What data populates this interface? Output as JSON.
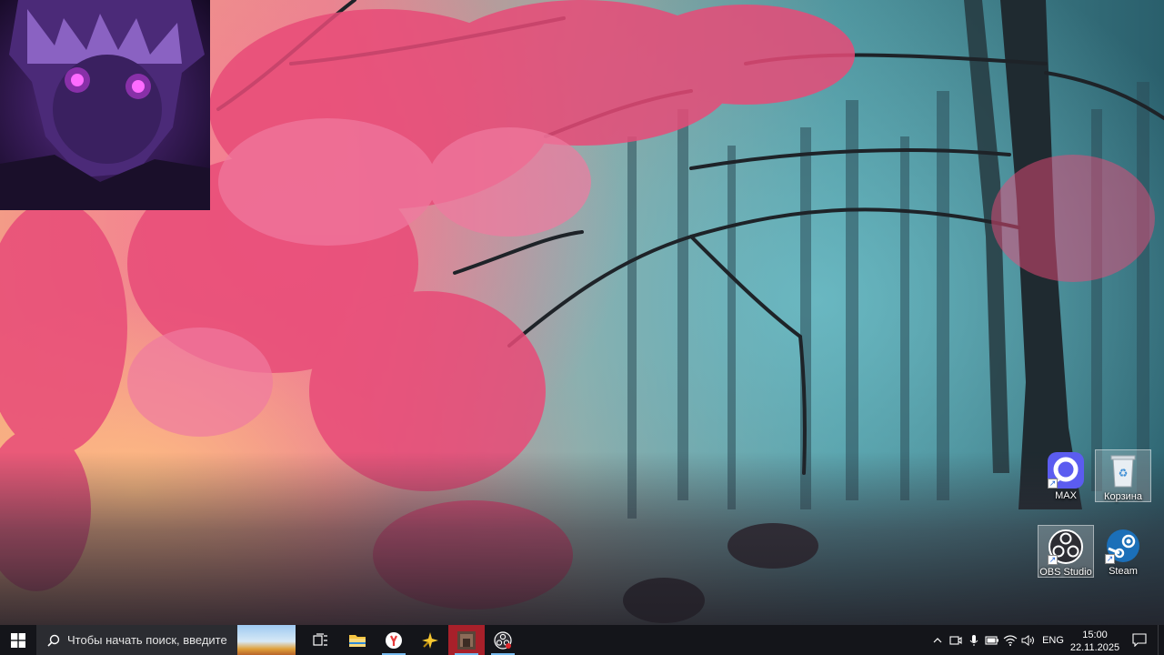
{
  "desktop": {
    "icons": [
      {
        "id": "max",
        "label": "MAX"
      },
      {
        "id": "recycle-bin",
        "label": "Корзина"
      },
      {
        "id": "obs",
        "label": "OBS Studio"
      },
      {
        "id": "steam",
        "label": "Steam"
      }
    ]
  },
  "taskbar": {
    "search_placeholder": "Чтобы начать поиск, введите",
    "pinned": [
      {
        "icon": "task-view-icon"
      },
      {
        "icon": "file-explorer-icon"
      },
      {
        "icon": "yandex-browser-icon"
      },
      {
        "icon": "sparkle-app-icon"
      },
      {
        "icon": "game-app-icon"
      },
      {
        "icon": "obs-studio-icon"
      }
    ],
    "tray": {
      "language": "ENG",
      "time": "15:00",
      "date": "22.11.2025"
    }
  },
  "colors": {
    "taskbar": "#14151a",
    "search_box": "#2b2c31",
    "accent_underline": "#76b9ed",
    "max_icon": "#5b5cf0",
    "steam_icon": "#1b6fb8"
  }
}
